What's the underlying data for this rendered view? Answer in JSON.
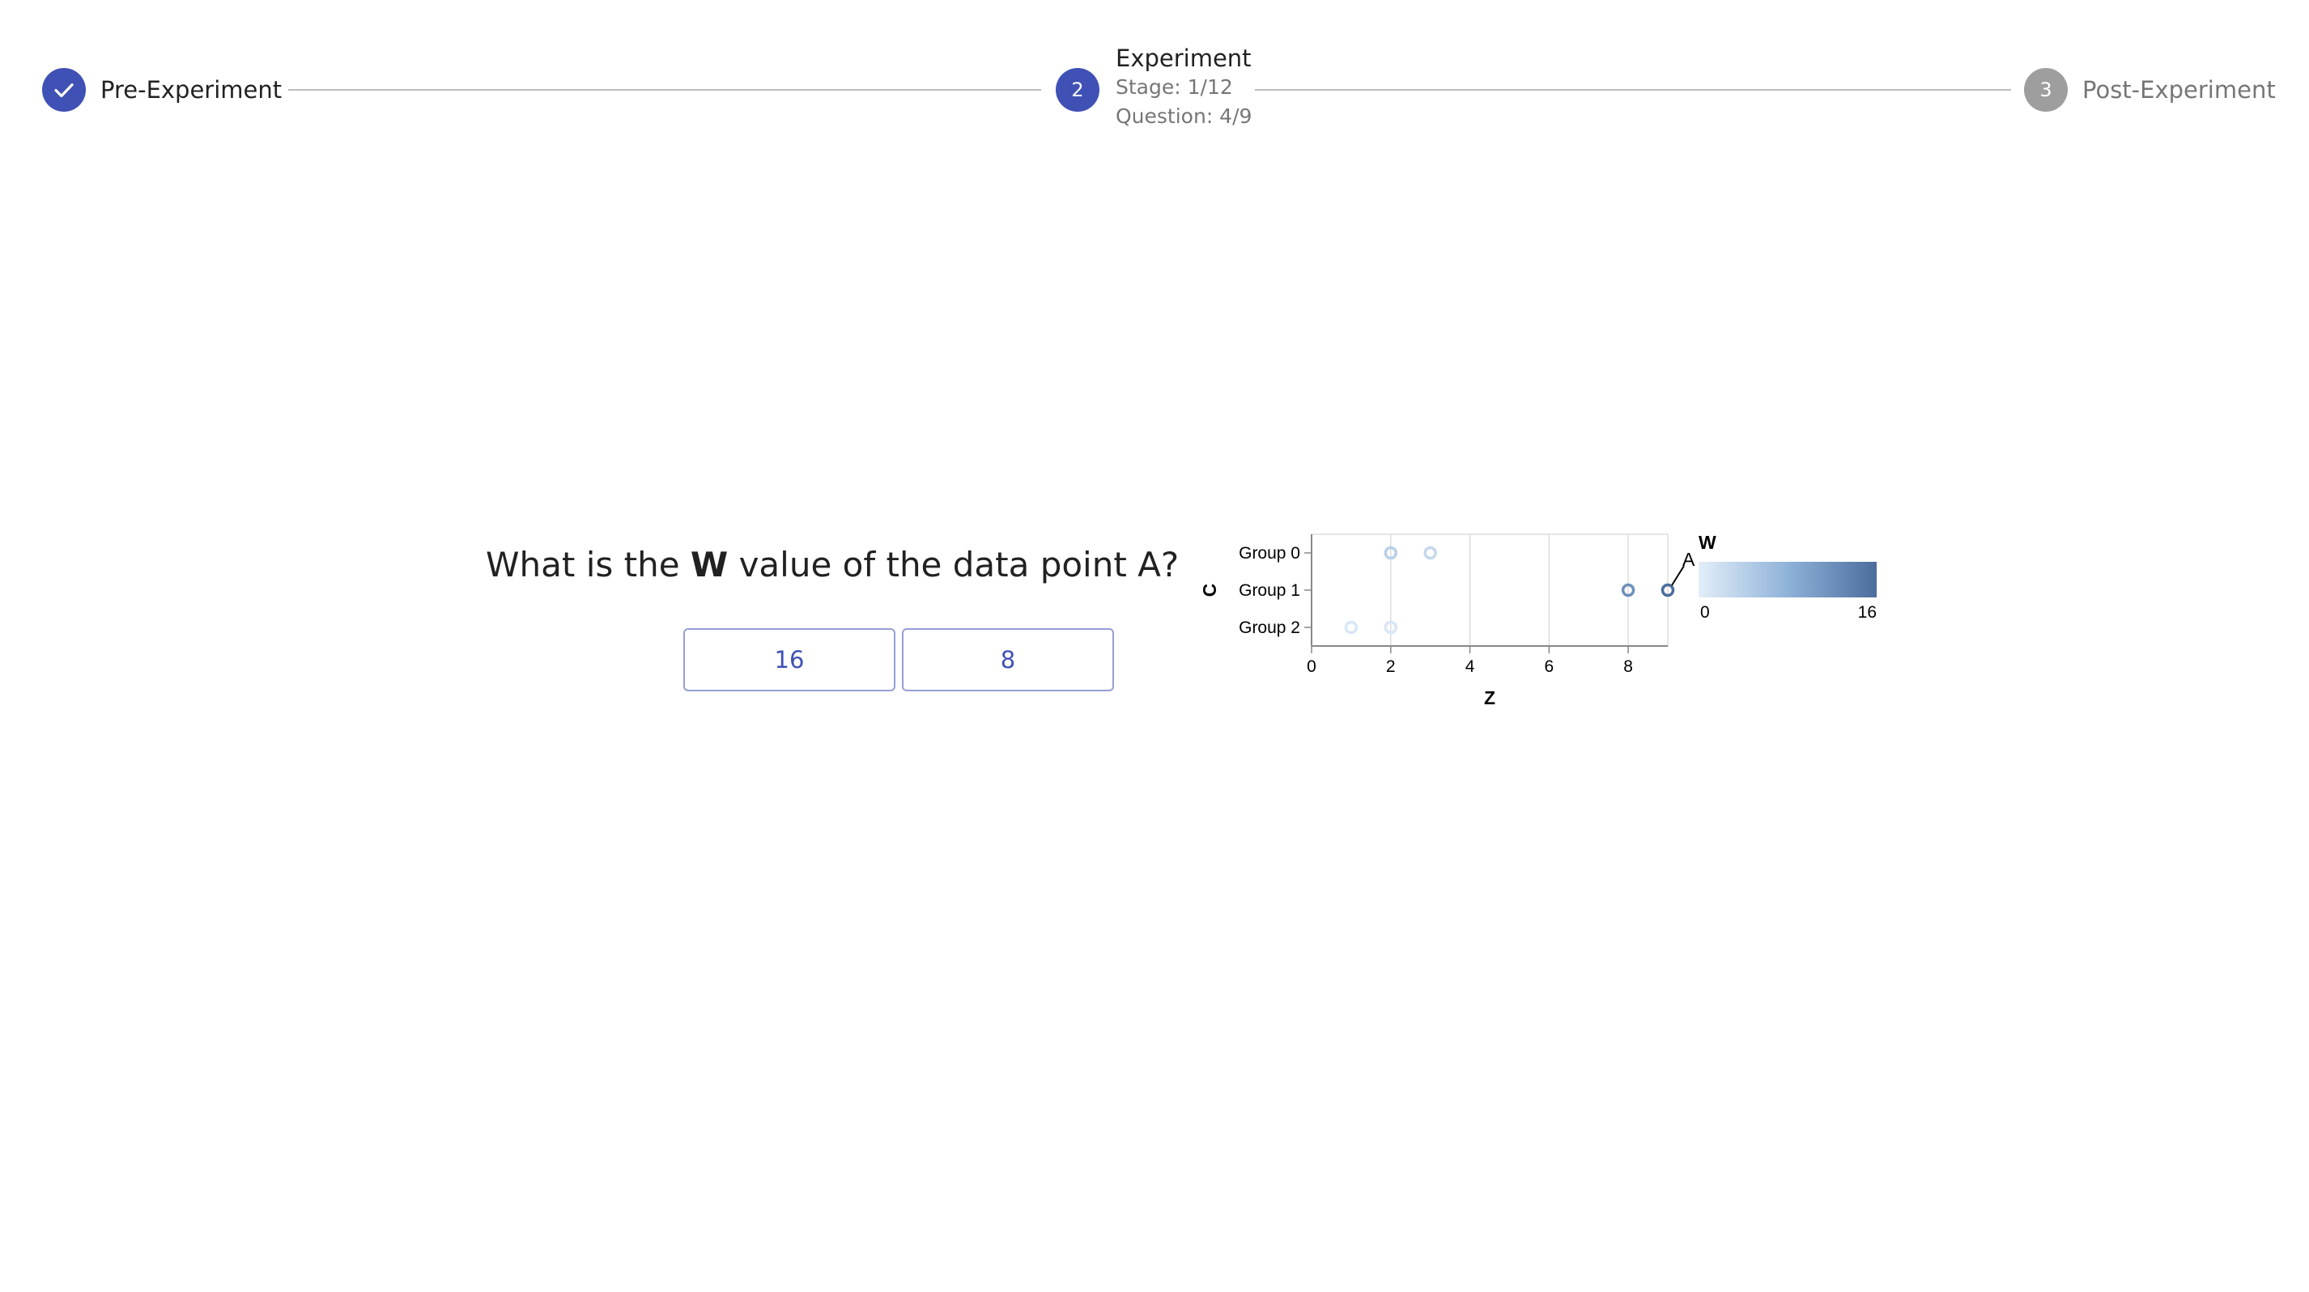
{
  "stepper": {
    "steps": [
      {
        "label": "Pre-Experiment",
        "status": "done",
        "icon": "check-icon"
      },
      {
        "number": "2",
        "label": "Experiment",
        "status": "active",
        "stage": "Stage: 1/12",
        "question": "Question: 4/9"
      },
      {
        "number": "3",
        "label": "Post-Experiment",
        "status": "pending"
      }
    ]
  },
  "question": {
    "prefix": "What is the ",
    "bold": "W",
    "suffix": " value of the data point A?"
  },
  "answers": [
    "16",
    "8"
  ],
  "colors": {
    "primary": "#3f51b5",
    "pending": "#9e9e9e",
    "connector": "#bdbdbd"
  },
  "chart_data": {
    "type": "scatter",
    "xlabel": "Z",
    "ylabel": "C",
    "xlim": [
      0,
      9
    ],
    "x_ticks": [
      "0",
      "2",
      "4",
      "6",
      "8"
    ],
    "categories": [
      "Group 0",
      "Group 1",
      "Group 2"
    ],
    "color_legend": {
      "title": "W",
      "min_label": "0",
      "max_label": "16",
      "min": 0,
      "max": 16
    },
    "points": [
      {
        "category": "Group 0",
        "z": 2,
        "w": 4
      },
      {
        "category": "Group 0",
        "z": 3,
        "w": 3
      },
      {
        "category": "Group 1",
        "z": 8,
        "w": 12
      },
      {
        "category": "Group 1",
        "z": 9,
        "w": 16,
        "label": "A"
      },
      {
        "category": "Group 2",
        "z": 1,
        "w": 1
      },
      {
        "category": "Group 2",
        "z": 2,
        "w": 1
      }
    ],
    "grid": true
  }
}
